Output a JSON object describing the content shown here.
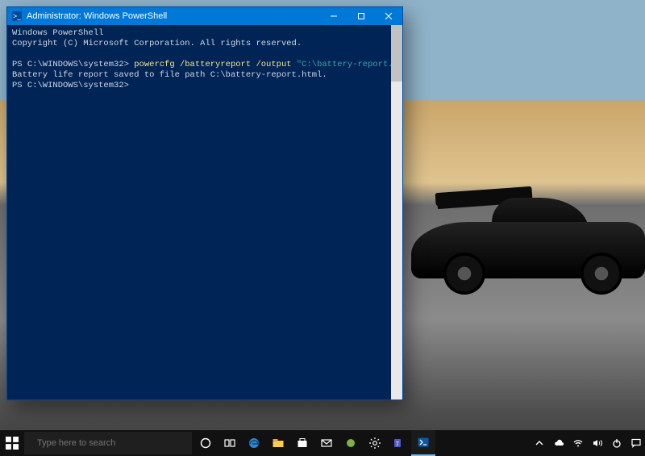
{
  "window": {
    "title": "Administrator: Windows PowerShell",
    "buttons": {
      "min": "Minimize",
      "max": "Maximize",
      "close": "Close"
    }
  },
  "terminal": {
    "line1": "Windows PowerShell",
    "line2": "Copyright (C) Microsoft Corporation. All rights reserved.",
    "prompt1_prefix": "PS C:\\WINDOWS\\system32> ",
    "prompt1_cmd": "powercfg /batteryreport /output ",
    "prompt1_arg": "\"C:\\battery-report.html\"",
    "line_saved": "Battery life report saved to file path C:\\battery-report.html.",
    "prompt2": "PS C:\\WINDOWS\\system32>"
  },
  "taskbar": {
    "search_placeholder": "Type here to search",
    "icons": {
      "start": "start-menu",
      "cortana": "cortana-ring",
      "taskview": "task-view",
      "edge": "microsoft-edge",
      "explorer": "file-explorer",
      "store": "microsoft-store",
      "mail": "mail",
      "app1": "android-app",
      "settings": "settings",
      "teams": "microsoft-teams",
      "powershell": "powershell"
    },
    "tray": {
      "chevron": "show-hidden",
      "onedrive": "onedrive",
      "wifi": "wifi",
      "volume": "volume",
      "power": "power",
      "notifications": "action-center"
    }
  },
  "colors": {
    "ps_bg": "#012456",
    "titlebar": "#0078d7",
    "taskbar": "#111111"
  }
}
